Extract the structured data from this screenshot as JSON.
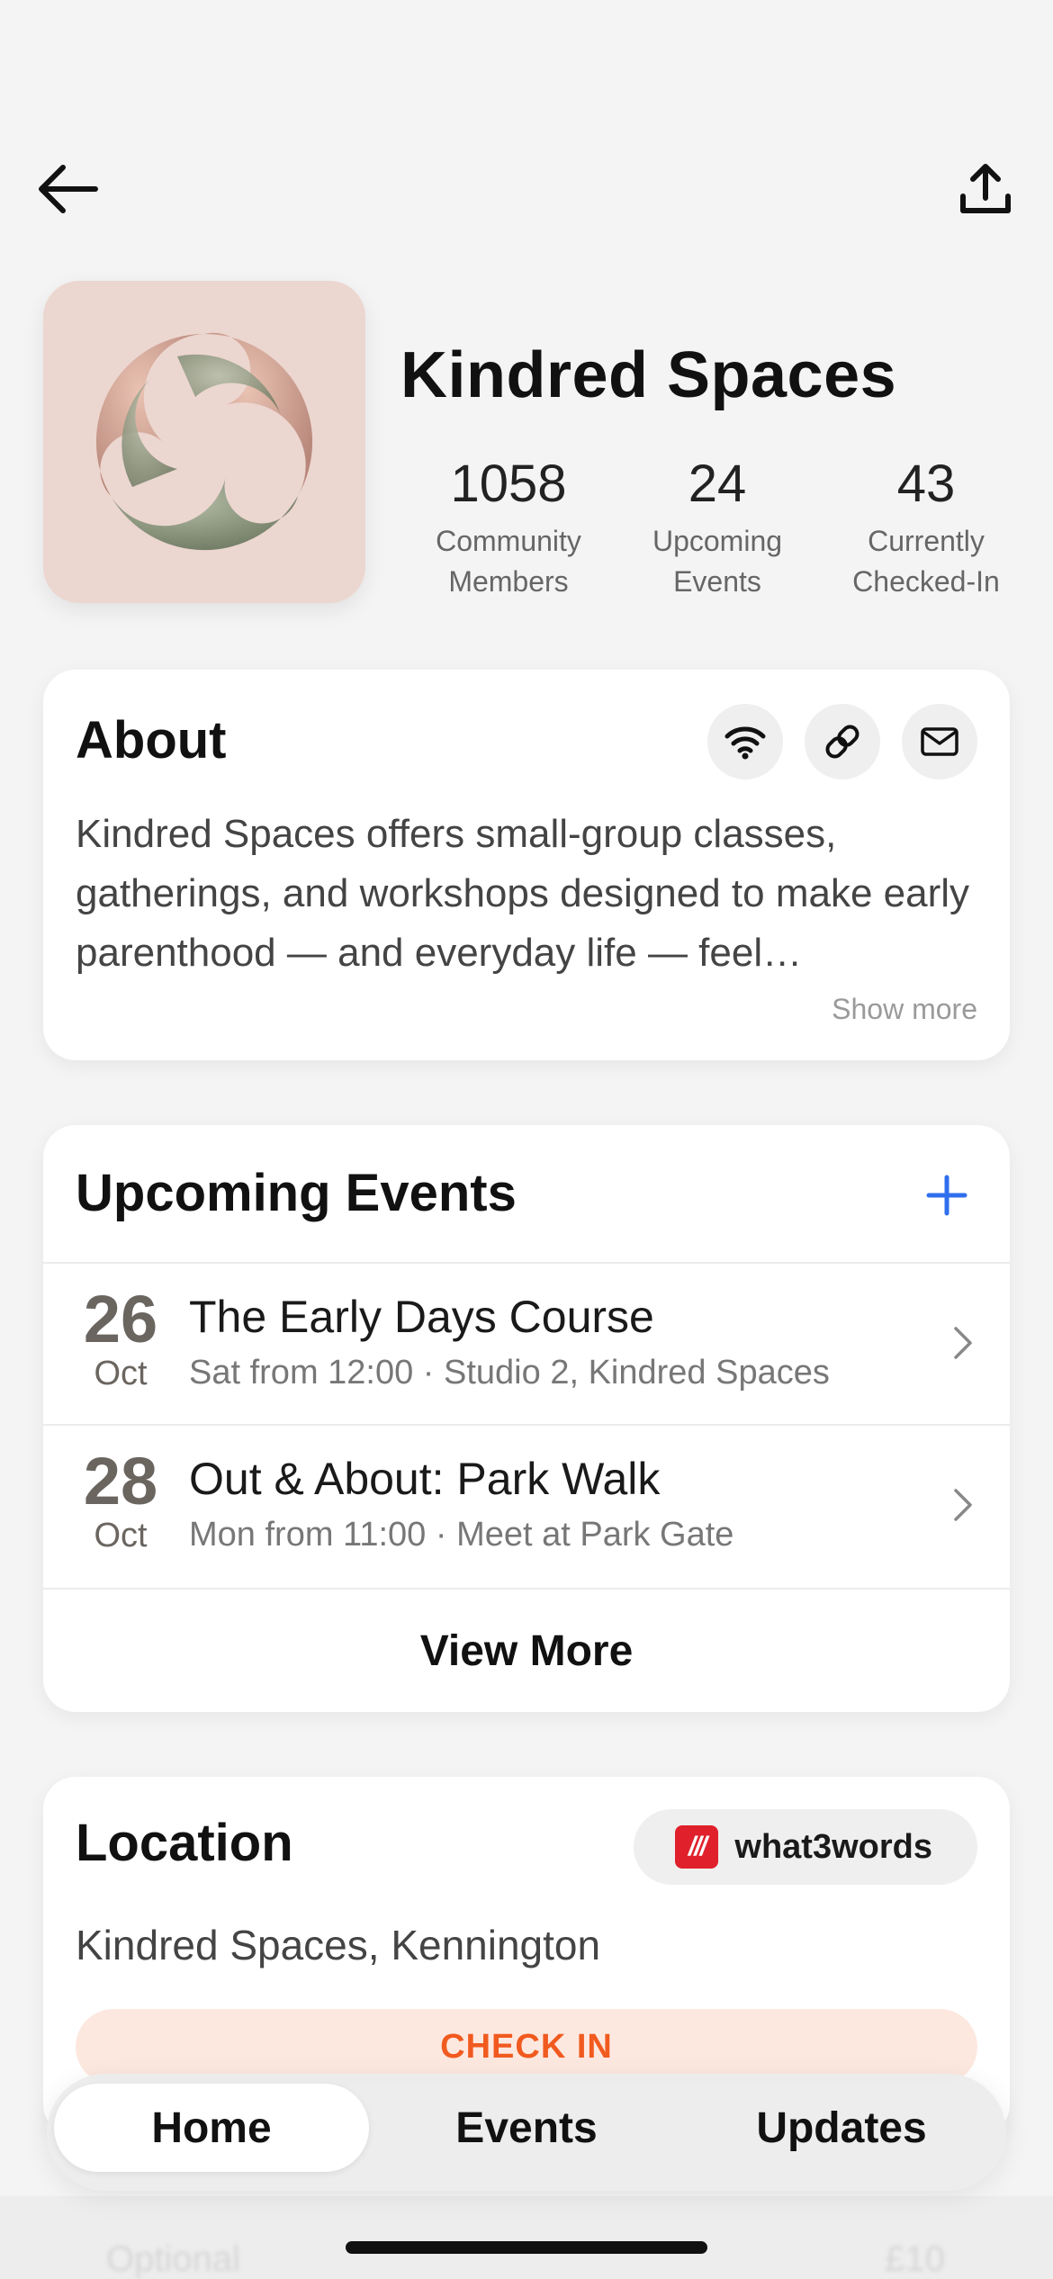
{
  "org": {
    "name": "Kindred Spaces",
    "stats": [
      {
        "value": "1058",
        "label": "Community\nMembers"
      },
      {
        "value": "24",
        "label": "Upcoming\nEvents"
      },
      {
        "value": "43",
        "label": "Currently\nChecked-In"
      }
    ]
  },
  "about": {
    "title": "About",
    "text": "Kindred Spaces offers small-group classes, gatherings, and workshops designed to make early parenthood — and everyday life — feel…",
    "show_more": "Show more",
    "icons": [
      "wifi-icon",
      "link-icon",
      "mail-icon"
    ]
  },
  "events": {
    "title": "Upcoming Events",
    "items": [
      {
        "day": "26",
        "month": "Oct",
        "title": "The Early Days Course",
        "subtitle": "Sat from 12:00 · Studio 2, Kindred Spaces"
      },
      {
        "day": "28",
        "month": "Oct",
        "title": "Out & About: Park Walk",
        "subtitle": "Mon from 11:00 · Meet at Park Gate"
      }
    ],
    "view_more": "View More"
  },
  "location": {
    "title": "Location",
    "w3w_logo": "///",
    "w3w_label": "what3words",
    "address": "Kindred Spaces, Kennington",
    "checkin_label": "CHECK IN"
  },
  "tabs": {
    "home": "Home",
    "events": "Events",
    "updates": "Updates"
  },
  "behind_tabbar": {
    "left": "Optional",
    "right": "£10"
  },
  "colors": {
    "accent_blue": "#2f6fed",
    "checkin_text": "#f15a1f",
    "checkin_bg": "#fde8e0",
    "logo_tile_bg": "#ecd6d0",
    "w3w_red": "#e0202b"
  }
}
